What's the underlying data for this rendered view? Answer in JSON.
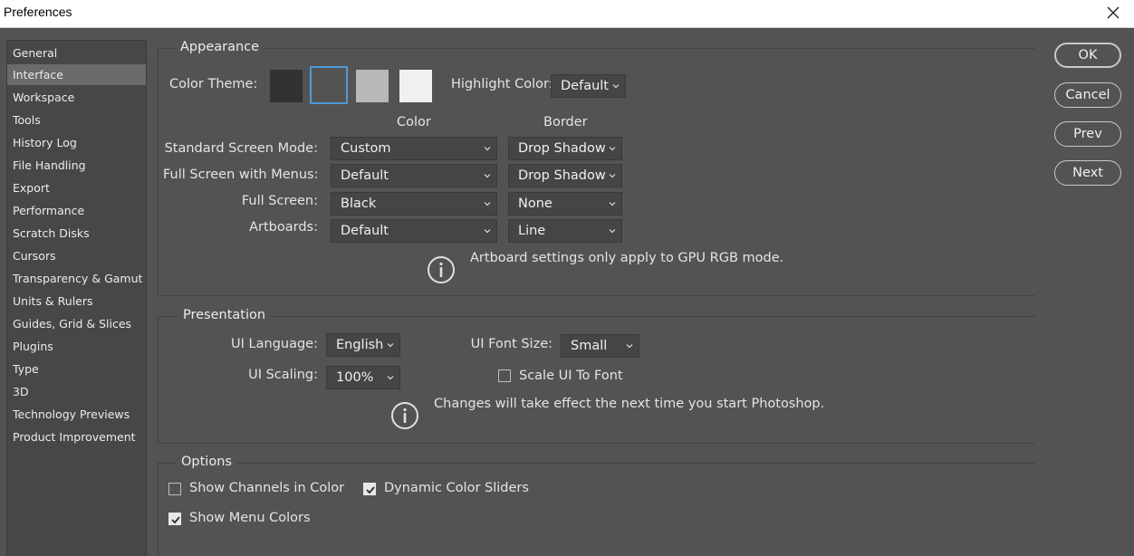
{
  "window": {
    "title": "Preferences"
  },
  "sidebar": {
    "items": [
      {
        "label": "General"
      },
      {
        "label": "Interface",
        "selected": true
      },
      {
        "label": "Workspace"
      },
      {
        "label": "Tools"
      },
      {
        "label": "History Log"
      },
      {
        "label": "File Handling"
      },
      {
        "label": "Export"
      },
      {
        "label": "Performance"
      },
      {
        "label": "Scratch Disks"
      },
      {
        "label": "Cursors"
      },
      {
        "label": "Transparency & Gamut"
      },
      {
        "label": "Units & Rulers"
      },
      {
        "label": "Guides, Grid & Slices"
      },
      {
        "label": "Plugins"
      },
      {
        "label": "Type"
      },
      {
        "label": "3D"
      },
      {
        "label": "Technology Previews"
      },
      {
        "label": "Product Improvement"
      }
    ]
  },
  "appearance": {
    "title": "Appearance",
    "color_theme_label": "Color Theme:",
    "themes": [
      {
        "name": "darkest",
        "color": "#323232"
      },
      {
        "name": "dark",
        "color": "#535353",
        "selected": true
      },
      {
        "name": "light",
        "color": "#b8b8b8"
      },
      {
        "name": "lightest",
        "color": "#f0f0f0"
      }
    ],
    "highlight_label": "Highlight Color:",
    "highlight_value": "Default",
    "col_color": "Color",
    "col_border": "Border",
    "rows": [
      {
        "label": "Standard Screen Mode:",
        "color": "Custom",
        "border": "Drop Shadow"
      },
      {
        "label": "Full Screen with Menus:",
        "color": "Default",
        "border": "Drop Shadow"
      },
      {
        "label": "Full Screen:",
        "color": "Black",
        "border": "None"
      },
      {
        "label": "Artboards:",
        "color": "Default",
        "border": "Line"
      }
    ],
    "note": "Artboard settings only apply to GPU RGB mode."
  },
  "presentation": {
    "title": "Presentation",
    "ui_language_label": "UI Language:",
    "ui_language_value": "English",
    "ui_font_size_label": "UI Font Size:",
    "ui_font_size_value": "Small",
    "ui_scaling_label": "UI Scaling:",
    "ui_scaling_value": "100%",
    "scale_ui_label": "Scale UI To Font",
    "scale_ui_checked": false,
    "note": "Changes will take effect the next time you start Photoshop."
  },
  "options": {
    "title": "Options",
    "show_channels_label": "Show Channels in Color",
    "show_channels_checked": false,
    "dynamic_sliders_label": "Dynamic Color Sliders",
    "dynamic_sliders_checked": true,
    "show_menu_colors_label": "Show Menu Colors",
    "show_menu_colors_checked": true
  },
  "buttons": {
    "ok": "OK",
    "cancel": "Cancel",
    "prev": "Prev",
    "next": "Next"
  },
  "colors": {
    "panel": "#535353",
    "sidebar": "#474747",
    "selected": "#6a6a6a",
    "accent": "#4f9ad6"
  }
}
